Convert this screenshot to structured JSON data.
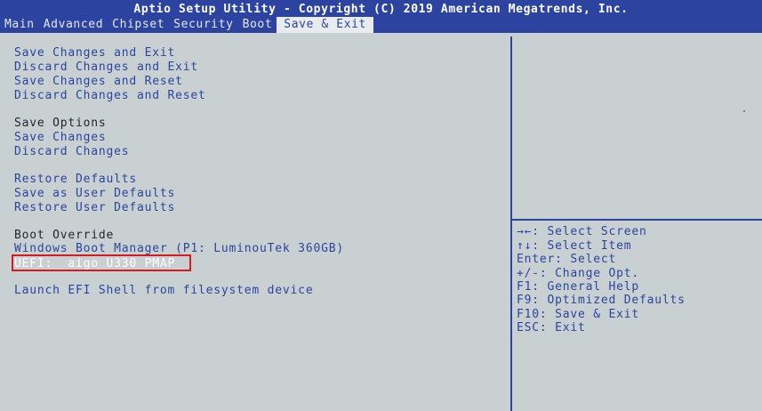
{
  "header": {
    "title": "Aptio Setup Utility - Copyright (C) 2019 American Megatrends, Inc.",
    "tabs": [
      "Main",
      "Advanced",
      "Chipset",
      "Security",
      "Boot",
      "Save & Exit"
    ],
    "active_tab": "Save & Exit"
  },
  "menu": {
    "save_changes_and_exit": "Save Changes and Exit",
    "discard_changes_and_exit": "Discard Changes and Exit",
    "save_changes_and_reset": "Save Changes and Reset",
    "discard_changes_and_reset": "Discard Changes and Reset",
    "save_options_header": "Save Options",
    "save_changes": "Save Changes",
    "discard_changes": "Discard Changes",
    "restore_defaults": "Restore Defaults",
    "save_as_user_defaults": "Save as User Defaults",
    "restore_user_defaults": "Restore User Defaults",
    "boot_override_header": "Boot Override",
    "boot_windows": "Windows Boot Manager (P1: LuminouTek 360GB)",
    "boot_uefi": "UEFI:  aigo U330 PMAP",
    "launch_efi_shell": "Launch EFI Shell from filesystem device"
  },
  "help": {
    "select_screen": "→←: Select Screen",
    "select_item": "↑↓: Select Item",
    "enter_select": "Enter: Select",
    "change_opt": "+/-: Change Opt.",
    "general_help": "F1: General Help",
    "optimized_defaults": "F9: Optimized Defaults",
    "save_exit": "F10: Save & Exit",
    "exit": "ESC: Exit"
  },
  "colors": {
    "header_bg": "#2c44a0",
    "body_bg": "#c9d0d2",
    "option_text": "#2c44a0",
    "highlight_box": "#d81920",
    "selected_text": "#ffffff"
  }
}
